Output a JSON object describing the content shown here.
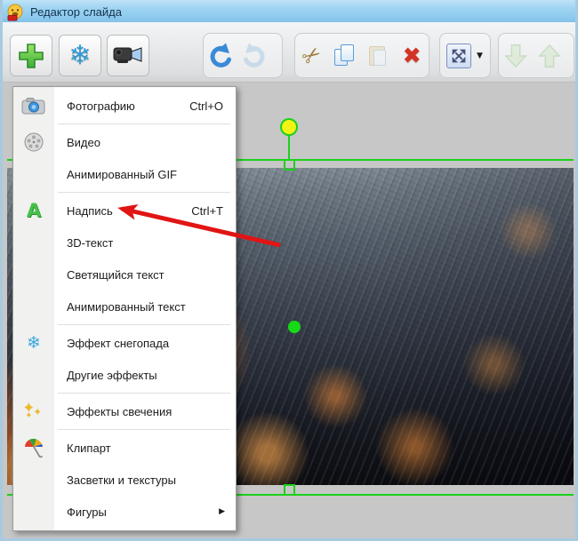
{
  "window": {
    "title": "Редактор слайда"
  },
  "toolbar": {
    "buttons": [
      {
        "name": "add-object",
        "icon": "plus-icon"
      },
      {
        "name": "snow-effect",
        "icon": "snowflake-icon"
      },
      {
        "name": "camera",
        "icon": "camcorder-icon"
      },
      {
        "name": "undo",
        "icon": "undo-arrow-icon",
        "enabled": true
      },
      {
        "name": "redo",
        "icon": "redo-arrow-icon",
        "enabled": false
      },
      {
        "name": "cut",
        "icon": "scissors-icon",
        "enabled": true
      },
      {
        "name": "copy",
        "icon": "copy-documents-icon",
        "enabled": true
      },
      {
        "name": "paste",
        "icon": "clipboard-icon",
        "enabled": false
      },
      {
        "name": "delete",
        "icon": "red-cross-icon",
        "enabled": true
      },
      {
        "name": "fit-view",
        "icon": "expand-arrows-icon",
        "enabled": true
      },
      {
        "name": "fit-view-dropdown",
        "icon": "caret-down-icon",
        "caret": "▼"
      },
      {
        "name": "move-down",
        "icon": "green-down-arrow-icon",
        "enabled": false
      },
      {
        "name": "move-up",
        "icon": "green-up-arrow-icon",
        "enabled": false
      }
    ]
  },
  "menu": {
    "items": [
      {
        "label": "Фотографию",
        "shortcut": "Ctrl+O",
        "icon": "camera-icon"
      },
      {
        "label": "Видео",
        "icon": "film-reel-icon"
      },
      {
        "label": "Анимированный GIF"
      },
      {
        "label": "Надпись",
        "shortcut": "Ctrl+T",
        "icon": "letter-a-icon"
      },
      {
        "label": "3D-текст"
      },
      {
        "label": "Светящийся текст"
      },
      {
        "label": "Анимированный текст"
      },
      {
        "label": "Эффект снегопада",
        "icon": "snowflake-icon"
      },
      {
        "label": "Другие эффекты"
      },
      {
        "label": "Эффекты свечения",
        "icon": "sparkles-icon"
      },
      {
        "label": "Клипарт",
        "icon": "umbrella-icon"
      },
      {
        "label": "Засветки и текстуры"
      },
      {
        "label": "Фигуры",
        "submenu_arrow": "▶"
      }
    ]
  },
  "slide": {
    "selection": {
      "handles": [
        "rotation-handle",
        "top-center-handle",
        "bottom-center-handle",
        "center-dot-handle"
      ]
    }
  },
  "annotation": {
    "arrow_points_to": "Надпись"
  },
  "colors": {
    "titlebar_blue": "#8ecbee",
    "selection_green": "#1ad11a",
    "rotation_handle_yellow": "#f2f215",
    "annotation_arrow_red": "#e21414"
  },
  "glyphs": {
    "snowflake": "❄",
    "scissors": "✂",
    "delete_cross": "✖",
    "sparkle": "✦"
  }
}
